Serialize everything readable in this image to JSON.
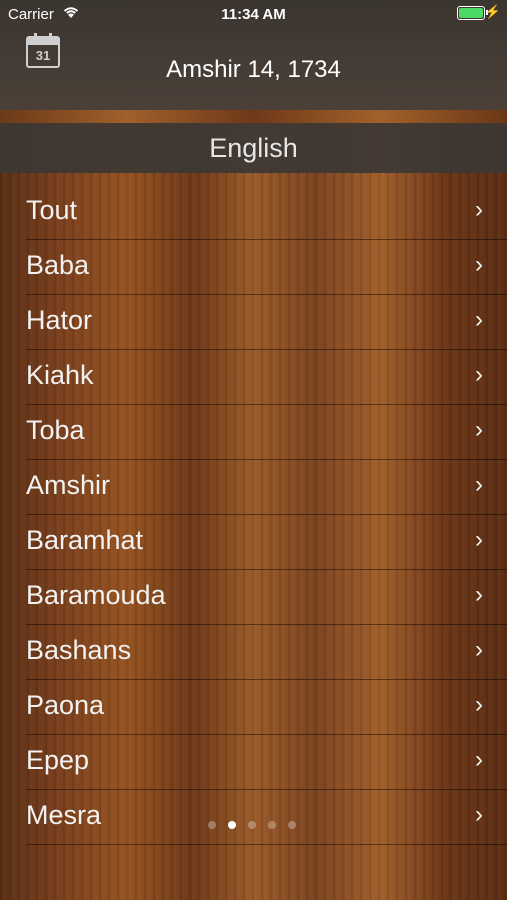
{
  "status_bar": {
    "carrier": "Carrier",
    "time": "11:34 AM"
  },
  "header": {
    "calendar_day": "31",
    "date": "Amshir 14, 1734"
  },
  "language": "English",
  "months": [
    "Tout",
    "Baba",
    "Hator",
    "Kiahk",
    "Toba",
    "Amshir",
    "Baramhat",
    "Baramouda",
    "Bashans",
    "Paona",
    "Epep",
    "Mesra"
  ],
  "page_indicator": {
    "count": 5,
    "active_index": 1
  },
  "colors": {
    "battery": "#4cd964",
    "header_bg": "#3b3530"
  }
}
